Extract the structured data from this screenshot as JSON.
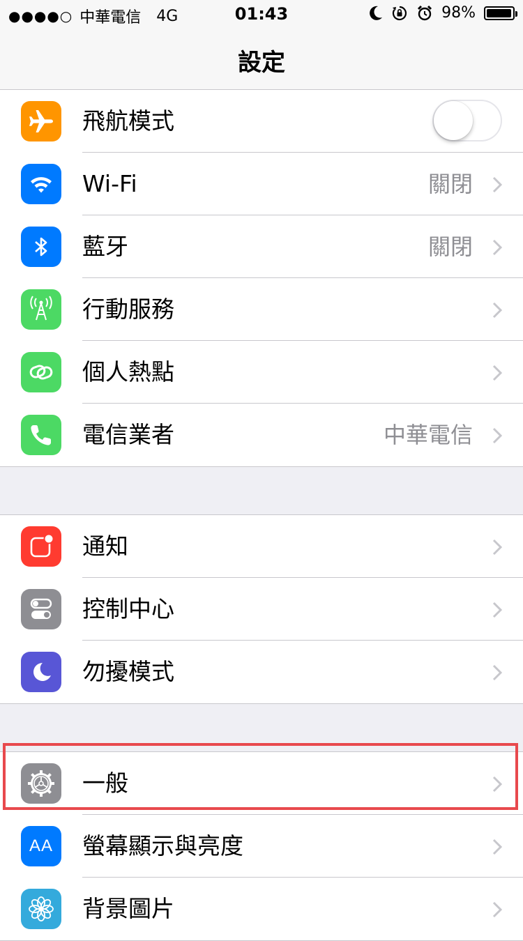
{
  "status_bar": {
    "signal_dots": "●●●●○",
    "carrier": "中華電信",
    "network": "4G",
    "time": "01:43",
    "battery_text": "98%",
    "battery_level": 0.98
  },
  "nav": {
    "title": "設定"
  },
  "colors": {
    "orange": "#ff9500",
    "blue": "#007aff",
    "green": "#4cd964",
    "red": "#ff3b30",
    "gray": "#8e8e93",
    "purple": "#5856d6",
    "teal": "#34aadc",
    "highlight": "#e8494d"
  },
  "groups": [
    {
      "rows": [
        {
          "label": "飛航模式",
          "icon": "airplane-icon",
          "control": "toggle",
          "toggle_on": false
        },
        {
          "label": "Wi-Fi",
          "icon": "wifi-icon",
          "value": "關閉"
        },
        {
          "label": "藍牙",
          "icon": "bluetooth-icon",
          "value": "關閉"
        },
        {
          "label": "行動服務",
          "icon": "cellular-antenna-icon"
        },
        {
          "label": "個人熱點",
          "icon": "hotspot-chain-icon"
        },
        {
          "label": "電信業者",
          "icon": "phone-icon",
          "value": "中華電信"
        }
      ]
    },
    {
      "rows": [
        {
          "label": "通知",
          "icon": "notifications-icon"
        },
        {
          "label": "控制中心",
          "icon": "control-center-icon"
        },
        {
          "label": "勿擾模式",
          "icon": "moon-icon"
        }
      ]
    },
    {
      "rows": [
        {
          "label": "一般",
          "icon": "gear-icon",
          "highlighted": true
        },
        {
          "label": "螢幕顯示與亮度",
          "icon": "display-brightness-icon",
          "icon_text": "AA"
        },
        {
          "label": "背景圖片",
          "icon": "wallpaper-flower-icon"
        }
      ]
    }
  ]
}
